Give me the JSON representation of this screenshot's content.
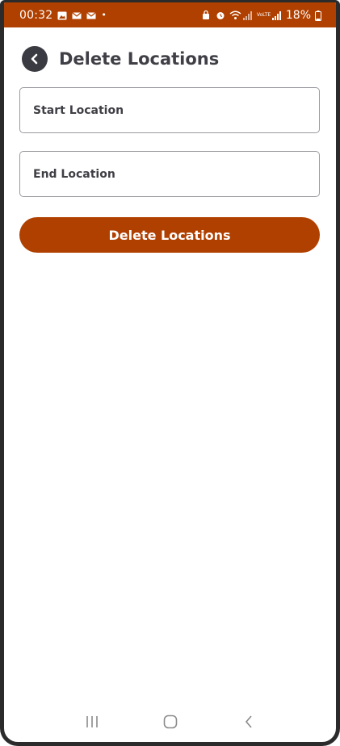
{
  "status_bar": {
    "time": "00:32",
    "dot": "•",
    "battery_percent": "18%",
    "network_label": "VoLTE"
  },
  "header": {
    "title": "Delete Locations"
  },
  "form": {
    "start_placeholder": "Start Location",
    "end_placeholder": "End Location",
    "submit_label": "Delete Locations"
  },
  "colors": {
    "brand": "#b04000",
    "text": "#3f3f46"
  }
}
